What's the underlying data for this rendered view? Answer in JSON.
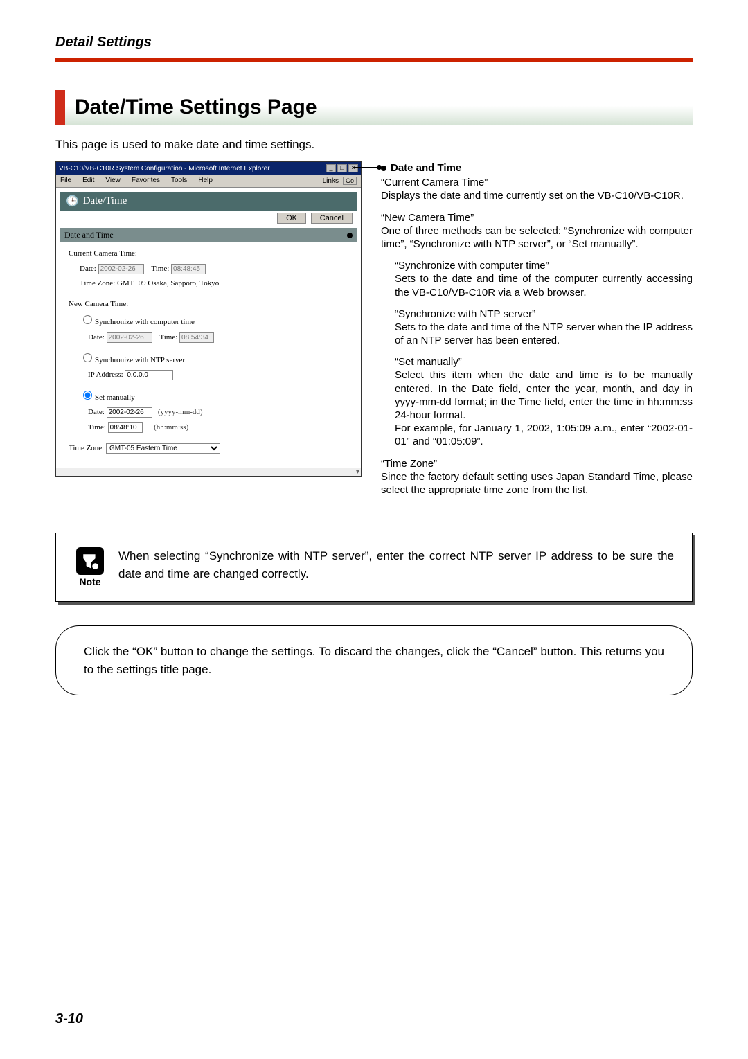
{
  "header": {
    "title": "Detail Settings"
  },
  "page_title": "Date/Time Settings Page",
  "intro": "This page is used to make date and time settings.",
  "browser": {
    "window_title": "VB-C10/VB-C10R System Configuration - Microsoft Internet Explorer",
    "menu": {
      "file": "File",
      "edit": "Edit",
      "view": "View",
      "favorites": "Favorites",
      "tools": "Tools",
      "help": "Help",
      "links": "Links",
      "go": "Go"
    },
    "panel_title": "Date/Time",
    "btn_ok": "OK",
    "btn_cancel": "Cancel",
    "section_title": "Date and Time",
    "form": {
      "current_label": "Current Camera Time:",
      "date_label": "Date:",
      "time_label": "Time:",
      "current_date": "2002-02-26",
      "current_time": "08:48:45",
      "tz_label": "Time Zone:",
      "current_tz": "GMT+09 Osaka, Sapporo, Tokyo",
      "new_label": "New Camera Time:",
      "opt1": "Synchronize with computer time",
      "opt1_date": "2002-02-26",
      "opt1_time": "08:54:34",
      "opt2": "Synchronize with NTP server",
      "ip_label": "IP Address:",
      "ip_value": "0.0.0.0",
      "opt3": "Set manually",
      "opt3_date": "2002-02-26",
      "opt3_time": "08:48:10",
      "hint_date": "(yyyy-mm-dd)",
      "hint_time": "(hh:mm:ss)",
      "tz_select": "GMT-05 Eastern Time"
    }
  },
  "desc": {
    "head": "Date and Time",
    "p1a": "“Current Camera Time”",
    "p1b": "Displays the date and time currently set on the VB-C10/VB-C10R.",
    "p2a": "“New Camera Time”",
    "p2b": "One of three methods can be selected: “Synchronize with computer time”, “Synchronize with NTP server”, or “Set manually”.",
    "p3a": "“Synchronize with computer time”",
    "p3b": "Sets to the date and time of the computer currently accessing the VB-C10/VB-C10R via a Web browser.",
    "p4a": "“Synchronize with NTP server”",
    "p4b": "Sets to the date and time of the NTP server when the IP address of an NTP server has been entered.",
    "p5a": "“Set manually”",
    "p5b": "Select this item when the date and time is to be manually entered. In the Date field, enter the year, month, and day in yyyy-mm-dd format; in the Time field, enter the time in hh:mm:ss 24-hour format.",
    "p5c": "For example, for January 1, 2002, 1:05:09 a.m., enter “2002-01-01” and “01:05:09”.",
    "p6a": "“Time Zone”",
    "p6b": "Since the factory default setting uses Japan Standard Time, please select the appropriate time zone from the list."
  },
  "note": {
    "label": "Note",
    "text": "When selecting “Synchronize with NTP server”, enter the correct NTP server IP address to be sure the date and time are changed correctly."
  },
  "round": {
    "text": "Click the “OK” button to change the settings. To discard the changes, click the “Cancel” button. This returns you to the settings title page."
  },
  "footer": {
    "page": "3-10"
  }
}
